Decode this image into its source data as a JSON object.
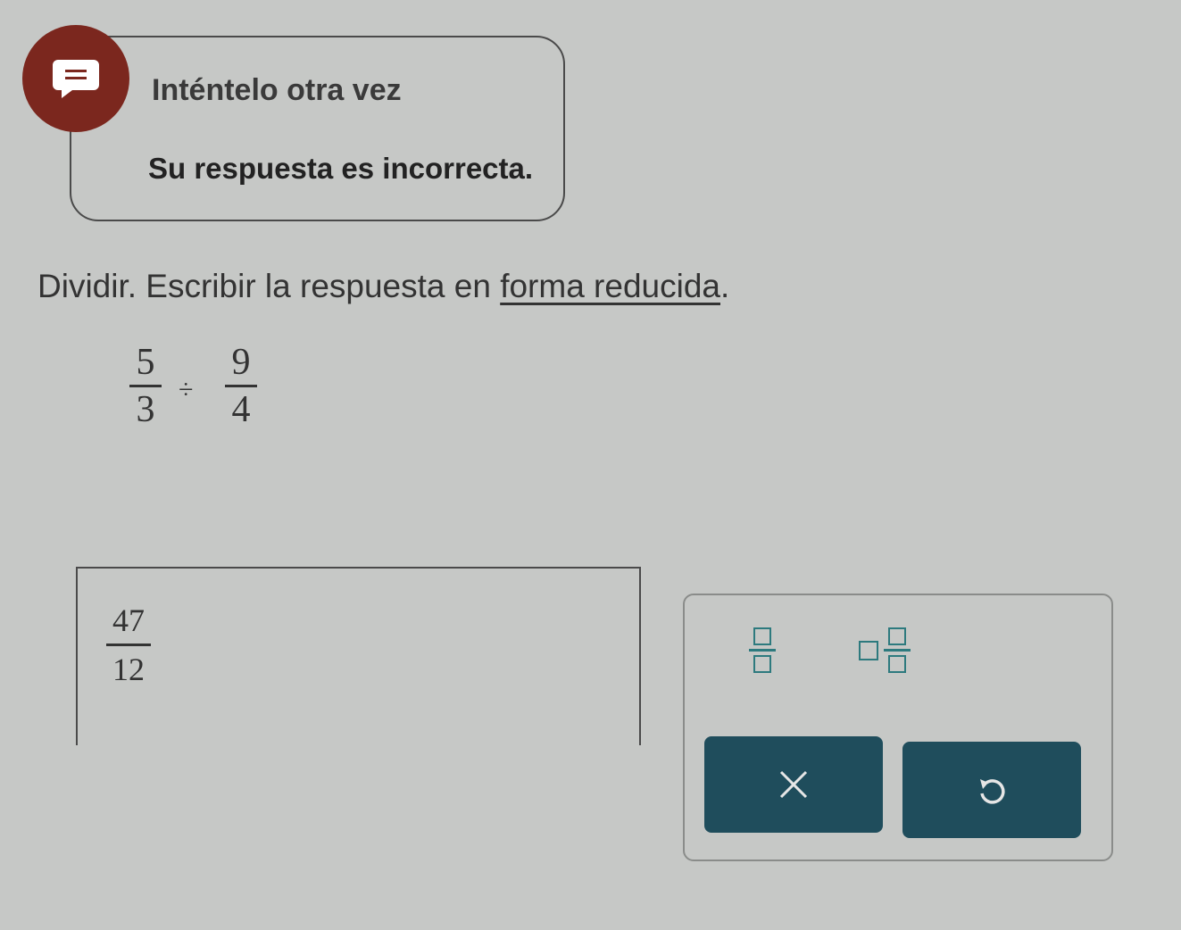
{
  "feedback": {
    "title": "Inténtelo otra vez",
    "message": "Su respuesta es incorrecta.",
    "icon": "chat-bubble-icon",
    "icon_color": "#7b271e"
  },
  "instruction": {
    "text": "Dividir. Escribir la respuesta en ",
    "link": "forma reducida",
    "end": "."
  },
  "problem": {
    "fraction1": {
      "numerator": "5",
      "denominator": "3"
    },
    "operator": "÷",
    "fraction2": {
      "numerator": "9",
      "denominator": "4"
    }
  },
  "answer": {
    "numerator": "47",
    "denominator": "12"
  },
  "keypad": {
    "templates": [
      "fraction-template-icon",
      "mixed-number-template-icon"
    ],
    "clear_icon": "close-icon",
    "undo_icon": "undo-icon",
    "button_color": "#1f4d5c",
    "template_color": "#2d7a7e"
  }
}
